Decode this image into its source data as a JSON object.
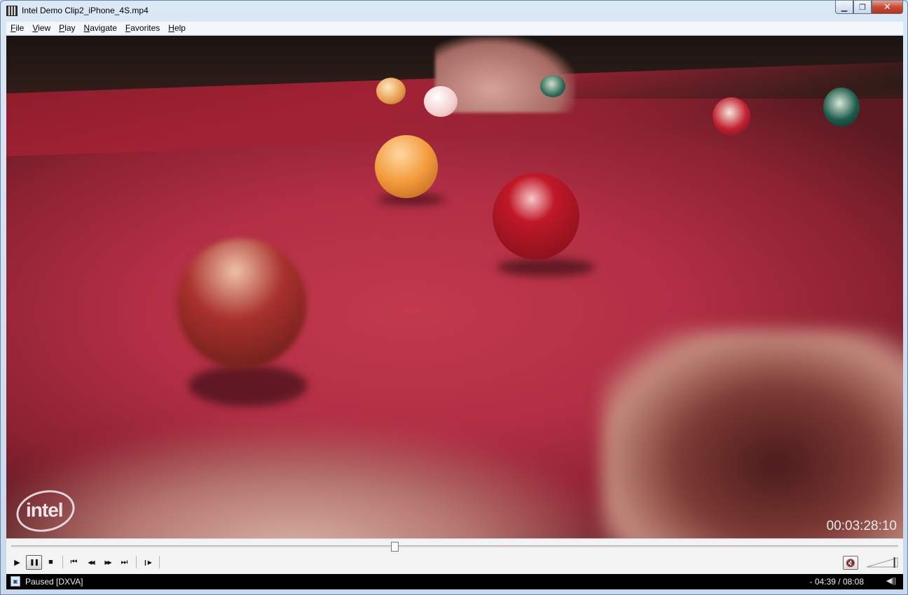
{
  "window": {
    "title": "Intel Demo Clip2_iPhone_4S.mp4",
    "minimize_glyph": "▁",
    "restore_glyph": "❐",
    "close_glyph": "✕"
  },
  "menu": {
    "items": [
      "File",
      "View",
      "Play",
      "Navigate",
      "Favorites",
      "Help"
    ]
  },
  "video": {
    "overlay_timecode": "00:03:28:10",
    "watermark": "intel"
  },
  "controls": {
    "seek_position_fraction": 0.432,
    "icons": {
      "play": "▶",
      "pause": "❚❚",
      "stop": "■",
      "prev": "⏮",
      "rewind": "◀◀",
      "forward": "▶▶",
      "next": "⏭",
      "frame_step": "❙▶",
      "mute": "🔇"
    },
    "volume_fraction": 0.9
  },
  "status": {
    "state": "Paused [DXVA]",
    "time": "- 04:39 / 08:08",
    "audio_icon": "◀||"
  }
}
